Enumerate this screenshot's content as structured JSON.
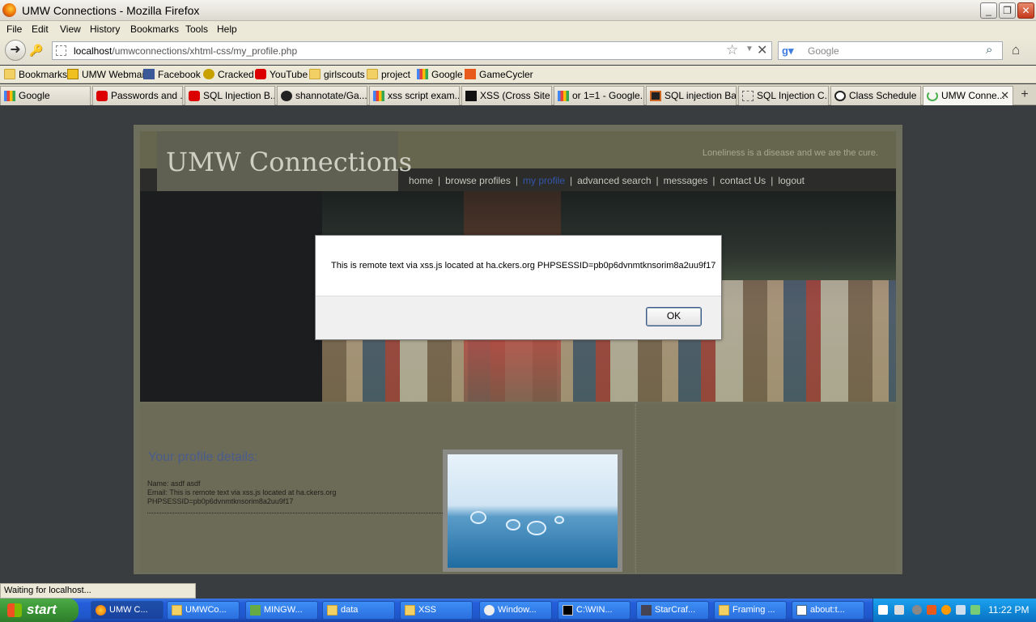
{
  "window": {
    "title": "UMW Connections - Mozilla Firefox"
  },
  "menu": [
    "File",
    "Edit",
    "View",
    "History",
    "Bookmarks",
    "Tools",
    "Help"
  ],
  "nav": {
    "url_host": "localhost",
    "url_path": "/umwconnections/xhtml-css/my_profile.php",
    "search_placeholder": "Google"
  },
  "bookmarks": [
    "Bookmarks",
    "UMW Webmail",
    "Facebook",
    "Cracked",
    "YouTube",
    "girlscouts",
    "project",
    "Google",
    "GameCycler"
  ],
  "tabs": [
    "Google",
    "Passwords and ...",
    "SQL Injection B...",
    "shannotate/Ga...",
    "xss script exam...",
    "XSS (Cross Site ...",
    "or 1=1 - Google...",
    "SQL injection Ba...",
    "SQL Injection C...",
    "Class Schedule ...",
    "UMW Conne..."
  ],
  "site": {
    "logo": "UMW Connections",
    "tagline": "Loneliness is a disease and we are the cure.",
    "nav": [
      "home",
      "browse profiles",
      "my profile",
      "advanced search",
      "messages",
      "contact Us",
      "logout"
    ],
    "profile_title": "Your profile details:",
    "name_line": "Name: asdf asdf",
    "email_line": "Email: This is remote text via xss.js located at ha.ckers.org",
    "session_line": "PHPSESSID=pb0p6dvnmtknsorim8a2uu9f17"
  },
  "dialog": {
    "message": "This is remote text via xss.js located at ha.ckers.org PHPSESSID=pb0p6dvnmtknsorim8a2uu9f17",
    "ok_label": "OK"
  },
  "status": {
    "text": "Waiting for localhost..."
  },
  "taskbar": {
    "start_label": "start",
    "items": [
      "UMW C...",
      "UMWCo...",
      "MINGW...",
      "data",
      "XSS",
      "Window...",
      "C:\\WIN...",
      "StarCraf...",
      "Framing ...",
      "about:t..."
    ],
    "clock": "11:22 PM"
  }
}
